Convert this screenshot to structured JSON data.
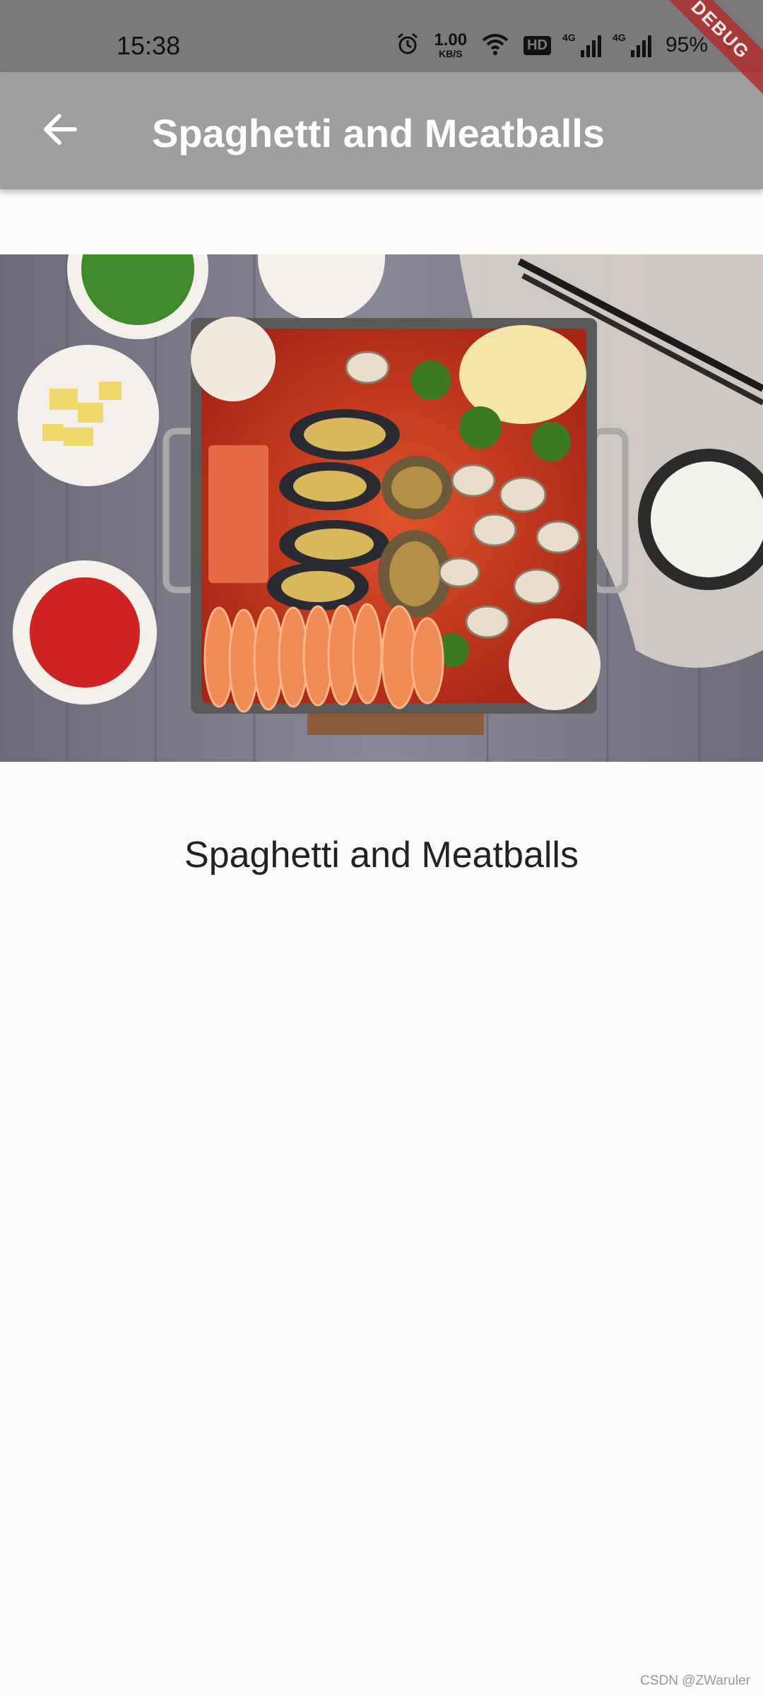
{
  "status_bar": {
    "time": "15:38",
    "net_speed_value": "1.00",
    "net_speed_unit": "KB/S",
    "hd_badge": "HD",
    "signal1_label": "4G",
    "signal2_label": "4G",
    "battery": "95%",
    "icons": [
      "alarm-icon",
      "wifi-icon",
      "signal-icon",
      "battery-charging-icon"
    ]
  },
  "debug_ribbon": "DEBUG",
  "app_bar": {
    "title": "Spaghetti and Meatballs",
    "back_icon": "arrow-back-icon"
  },
  "detail": {
    "dish_name": "Spaghetti and Meatballs"
  },
  "watermark": "CSDN @ZWaruler",
  "colors": {
    "app_bar": "#9e9e9e",
    "status_bar": "#7a7a7a",
    "background": "#fafafa",
    "debug_ribbon": "#b02f2f"
  }
}
